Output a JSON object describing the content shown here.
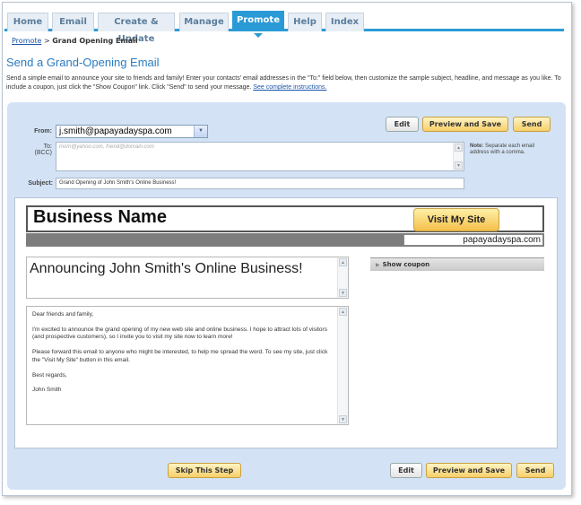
{
  "tabs": [
    {
      "label": "Home"
    },
    {
      "label": "Email"
    },
    {
      "label": "Create & Update"
    },
    {
      "label": "Manage"
    },
    {
      "label": "Promote"
    },
    {
      "label": "Help"
    },
    {
      "label": "Index"
    }
  ],
  "active_tab": "Promote",
  "breadcrumb": {
    "link": "Promote",
    "separator": ">",
    "current": "Grand Opening Email"
  },
  "page_title": "Send a Grand-Opening Email",
  "intro": {
    "text": "Send a simple email to announce your site to friends and family! Enter your contacts' email addresses in the \"To:\" field below, then customize the sample subject, headline, and message as you like. To include a coupon, just click the \"Show Coupon\" link. Click \"Send\" to send your message.",
    "link": "See complete instructions."
  },
  "toolbar": {
    "edit": "Edit",
    "preview_save": "Preview and Save",
    "send": "Send"
  },
  "form": {
    "from_label": "From:",
    "from_value": "j.smith@papayadayspa.com",
    "to_label": "To:",
    "bcc_label": "(BCC)",
    "to_placeholder": "mom@yahoo.com, friend@domain.com",
    "note_bold": "Note:",
    "note_text": "Separate each email address with a comma.",
    "subject_label": "Subject:",
    "subject_value": "Grand Opening of John Smith's Online Business!"
  },
  "email": {
    "business_name": "Business Name",
    "visit_button": "Visit My Site",
    "domain": "papayadayspa.com",
    "headline": "Announcing John Smith's Online Business!",
    "body": [
      "Dear friends and family,",
      "I'm excited to announce the grand opening of my new web site and online business. I hope to attract lots of visitors (and prospective customers), so I invite you to visit my site now to learn more!",
      "Please forward this email to anyone who might be interested, to help me spread the word. To see my site, just click the \"Visit My Site\" button in this email.",
      "Best regards,",
      "John Smith"
    ],
    "show_coupon": "Show coupon"
  },
  "footer": {
    "skip": "Skip This Step",
    "edit": "Edit",
    "preview_save": "Preview and Save",
    "send": "Send"
  },
  "colors": {
    "accent": "#2a9ad6",
    "panel": "#d3e3f5",
    "gold_button": "#f7cf6a"
  }
}
